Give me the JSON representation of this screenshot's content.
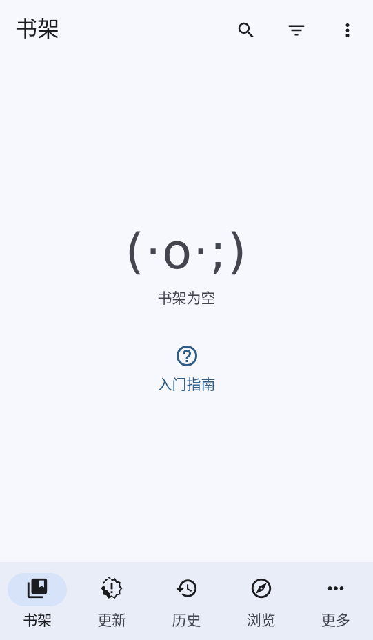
{
  "header": {
    "title": "书架",
    "actions": [
      {
        "name": "search-button",
        "icon": "search-icon"
      },
      {
        "name": "filter-button",
        "icon": "filter-icon"
      },
      {
        "name": "overflow-menu-button",
        "icon": "more-vert-icon"
      }
    ]
  },
  "empty_state": {
    "kaomoji": "(·o·;)",
    "message": "书架为空"
  },
  "guide": {
    "icon": "help-circle-icon",
    "label": "入门指南"
  },
  "bottom_nav": {
    "items": [
      {
        "label": "书架",
        "icon": "library-icon",
        "active": true
      },
      {
        "label": "更新",
        "icon": "new-releases-icon",
        "active": false
      },
      {
        "label": "历史",
        "icon": "history-icon",
        "active": false
      },
      {
        "label": "浏览",
        "icon": "explore-icon",
        "active": false
      },
      {
        "label": "更多",
        "icon": "more-horiz-icon",
        "active": false
      }
    ]
  },
  "colors": {
    "background": "#f7f8fd",
    "nav_background": "#e9edf8",
    "active_pill": "#d7e3f8",
    "link": "#2f5d86",
    "text_secondary": "#44464f"
  }
}
